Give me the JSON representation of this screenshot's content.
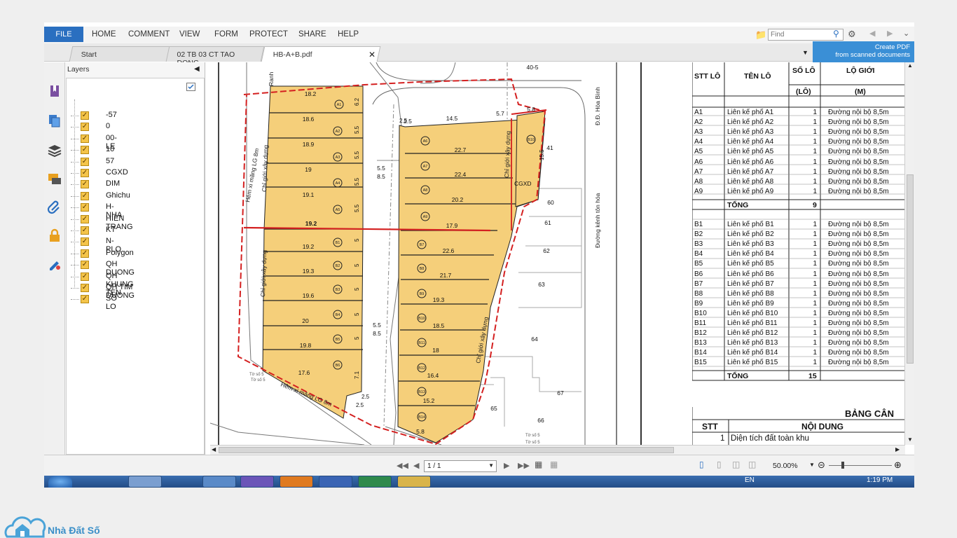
{
  "ribbon": {
    "file": "FILE",
    "menus": [
      "HOME",
      "COMMENT",
      "VIEW",
      "FORM",
      "PROTECT",
      "SHARE",
      "HELP"
    ],
    "find_placeholder": "Find"
  },
  "tabs": [
    {
      "label": "Start",
      "active": false
    },
    {
      "label": "02 TB 03 CT TAO DONG...",
      "active": false
    },
    {
      "label": "HB-A+B.pdf",
      "active": true
    }
  ],
  "create_pdf": {
    "line1": "Create PDF",
    "line2": "from scanned documents"
  },
  "layers": {
    "title": "Layers",
    "items": [
      "-57",
      "0",
      "00-LE",
      "10",
      "57",
      "CGXD",
      "DIM",
      "Ghichu",
      "H-NHA",
      "HIEN TRANG",
      "KT",
      "N-PLO",
      "Polygon",
      "QH DUONG",
      "QH KHUNG TEN",
      "QH TIM DUONG",
      "SO LO"
    ]
  },
  "map": {
    "roads": [
      "Hẻm xi măng LG 8m",
      "Hẻm xi măng LG 8m",
      "Đường kênh tôn hóa",
      "Đ.Đ. Hòa Bình",
      "Ranh"
    ],
    "build_line": "Chỉ giới xây dựng",
    "cgxd": "CGXD",
    "lots_A": [
      {
        "id": "A1",
        "w": "18.2",
        "d": "6.2"
      },
      {
        "id": "A2",
        "w": "18.6",
        "d": "5.5"
      },
      {
        "id": "A3",
        "w": "18.9",
        "d": "5.5"
      },
      {
        "id": "A4",
        "w": "19",
        "d": "5.5"
      },
      {
        "id": "A5",
        "w": "19.1",
        "d": "5.5"
      },
      {
        "id": "",
        "w": "19.2",
        "d": ""
      }
    ],
    "lots_B_left": [
      {
        "id": "B1",
        "w": "19.2",
        "d": "5"
      },
      {
        "id": "B2",
        "w": "19.3",
        "d": "5"
      },
      {
        "id": "B3",
        "w": "19.6",
        "d": "5"
      },
      {
        "id": "B4",
        "w": "20",
        "d": "5"
      },
      {
        "id": "B5",
        "w": "19.8",
        "d": "5"
      },
      {
        "id": "B6",
        "w": "17.6",
        "d": "7.1"
      }
    ],
    "lots_right": [
      {
        "id": "A6",
        "w": "22.7"
      },
      {
        "id": "A7",
        "w": "22.4"
      },
      {
        "id": "A8",
        "w": "20.2"
      },
      {
        "id": "A9",
        "w": "17.9"
      },
      {
        "id": "B7",
        "w": "22.6"
      },
      {
        "id": "B8",
        "w": "21.7"
      },
      {
        "id": "B9",
        "w": "19.3"
      },
      {
        "id": "B10",
        "w": "18.5"
      },
      {
        "id": "B11",
        "w": "18"
      },
      {
        "id": "B12",
        "w": "16.4"
      },
      {
        "id": "B13",
        "w": "15.2"
      },
      {
        "id": "B14",
        "w": "5.8"
      }
    ],
    "extra": [
      "40-5",
      "14.5",
      "5.7",
      "5.8",
      "15.5",
      "2.5",
      "5.5",
      "8.5",
      "2.5",
      "5.5",
      "8.5",
      "2.5",
      "2.5"
    ],
    "plot_numbers": [
      "41",
      "60",
      "61",
      "62",
      "63",
      "64",
      "65",
      "66",
      "67"
    ],
    "b10": "B10",
    "map_notes": [
      "Tờ số 5",
      "Tờ số 5",
      "Tờ số 5",
      "Tờ số 5"
    ]
  },
  "table": {
    "headers": [
      "STT LÔ",
      "TÊN LÔ",
      "SỐ LÔ",
      "LỘ GIỚI"
    ],
    "units": [
      "(LÔ)",
      "(M)"
    ],
    "rows_A": [
      [
        "A1",
        "Liên kế phố A1",
        "1",
        "Đường nội bộ 8,5m"
      ],
      [
        "A2",
        "Liên kế phố A2",
        "1",
        "Đường nội bộ 8,5m"
      ],
      [
        "A3",
        "Liên kế phố A3",
        "1",
        "Đường nội bộ 8,5m"
      ],
      [
        "A4",
        "Liên kế phố A4",
        "1",
        "Đường nội bộ 8,5m"
      ],
      [
        "A5",
        "Liên kế phố A5",
        "1",
        "Đường nội bộ 8,5m"
      ],
      [
        "A6",
        "Liên kế phố A6",
        "1",
        "Đường nội bộ 8,5m"
      ],
      [
        "A7",
        "Liên kế phố A7",
        "1",
        "Đường nội bộ 8,5m"
      ],
      [
        "A8",
        "Liên kế phố A8",
        "1",
        "Đường nội bộ 8,5m"
      ],
      [
        "A9",
        "Liên kế phố A9",
        "1",
        "Đường nội bộ 8,5m"
      ]
    ],
    "total_A": [
      "TỔNG",
      "9"
    ],
    "rows_B": [
      [
        "B1",
        "Liên kế phố B1",
        "1",
        "Đường nội bộ 8,5m"
      ],
      [
        "B2",
        "Liên kế phố B2",
        "1",
        "Đường nội bộ 8,5m"
      ],
      [
        "B3",
        "Liên kế phố B3",
        "1",
        "Đường nội bộ 8,5m"
      ],
      [
        "B4",
        "Liên kế phố B4",
        "1",
        "Đường nội bộ 8,5m"
      ],
      [
        "B5",
        "Liên kế phố B5",
        "1",
        "Đường nội bộ 8,5m"
      ],
      [
        "B6",
        "Liên kế phố B6",
        "1",
        "Đường nội bộ 8,5m"
      ],
      [
        "B7",
        "Liên kế phố B7",
        "1",
        "Đường nội bộ 8,5m"
      ],
      [
        "B8",
        "Liên kế phố B8",
        "1",
        "Đường nội bộ 8,5m"
      ],
      [
        "B9",
        "Liên kế phố B9",
        "1",
        "Đường nội bộ 8,5m"
      ],
      [
        "B10",
        "Liên kế phố B10",
        "1",
        "Đường nội bộ 8,5m"
      ],
      [
        "B11",
        "Liên kế phố B11",
        "1",
        "Đường nội bộ 8,5m"
      ],
      [
        "B12",
        "Liên kế phố B12",
        "1",
        "Đường nội bộ 8,5m"
      ],
      [
        "B13",
        "Liên kế phố B13",
        "1",
        "Đường nội bộ 8,5m"
      ],
      [
        "B14",
        "Liên kế phố B14",
        "1",
        "Đường nội bộ 8,5m"
      ],
      [
        "B15",
        "Liên kế phố B15",
        "1",
        "Đường nội bộ 8,5m"
      ]
    ],
    "total_B": [
      "TỔNG",
      "15"
    ],
    "table2_title": "BẢNG CÂN",
    "table2_headers": [
      "STT",
      "NỘI DUNG"
    ],
    "table2_row": [
      "1",
      "Diện tích đất toàn khu"
    ]
  },
  "status": {
    "page": "1 / 1",
    "zoom": "50.00%"
  },
  "taskbar": {
    "lang": "EN",
    "time": "1:19 PM"
  },
  "watermark": "Nhà Đất Số",
  "colors": {
    "lot_fill": "#f5cf7a",
    "red_line": "#d42020",
    "accent": "#2a6fc0"
  }
}
